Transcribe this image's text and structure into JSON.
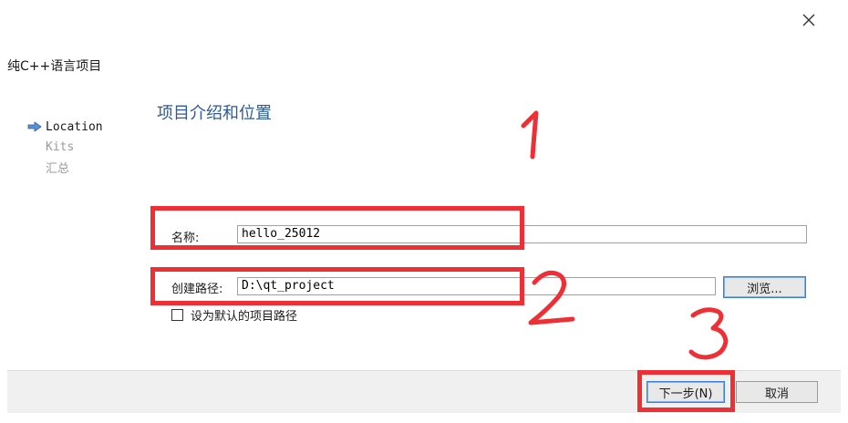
{
  "window": {
    "title": "纯C++语言项目",
    "close_icon": "close-icon"
  },
  "steps": [
    {
      "label": "Location",
      "active": true
    },
    {
      "label": "Kits",
      "active": false
    },
    {
      "label": "汇总",
      "active": false
    }
  ],
  "page": {
    "title": "项目介绍和位置"
  },
  "form": {
    "name_label": "名称:",
    "name_value": "hello_25012",
    "path_label": "创建路径:",
    "path_value": "D:\\qt_project",
    "browse_label": "浏览...",
    "default_path_label": "设为默认的项目路径",
    "default_path_checked": false
  },
  "footer": {
    "next_label": "下一步(N)",
    "cancel_label": "取消"
  },
  "annotations": {
    "color": "#ee2f36",
    "numbers": [
      "1",
      "2",
      "3"
    ]
  }
}
